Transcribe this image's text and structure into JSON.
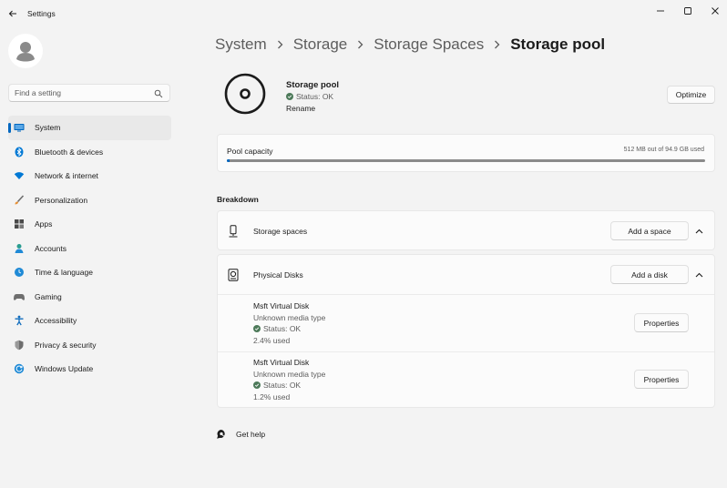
{
  "window": {
    "title": "Settings",
    "back_icon": "back-arrow-icon",
    "controls": [
      "minimize-icon",
      "maximize-icon",
      "close-icon"
    ]
  },
  "search": {
    "placeholder": "Find a setting",
    "value": ""
  },
  "sidebar": {
    "items": [
      {
        "label": "System",
        "icon": "system-icon",
        "active": true,
        "color": "#0067c0"
      },
      {
        "label": "Bluetooth & devices",
        "icon": "bluetooth-icon",
        "color": "#0078d4"
      },
      {
        "label": "Network & internet",
        "icon": "wifi-icon",
        "color": "#0078d4"
      },
      {
        "label": "Personalization",
        "icon": "brush-icon",
        "color": "#6e6e6e"
      },
      {
        "label": "Apps",
        "icon": "apps-icon",
        "color": "#4a4a4a"
      },
      {
        "label": "Accounts",
        "icon": "accounts-icon",
        "color": "#2a9d8f"
      },
      {
        "label": "Time & language",
        "icon": "globe-clock-icon",
        "color": "#1f8ad6"
      },
      {
        "label": "Gaming",
        "icon": "gamepad-icon",
        "color": "#6e6e6e"
      },
      {
        "label": "Accessibility",
        "icon": "accessibility-icon",
        "color": "#0f6cbd"
      },
      {
        "label": "Privacy & security",
        "icon": "shield-icon",
        "color": "#6e6e6e"
      },
      {
        "label": "Windows Update",
        "icon": "update-icon",
        "color": "#1f8ad6"
      }
    ]
  },
  "breadcrumb": [
    "System",
    "Storage",
    "Storage Spaces",
    "Storage pool"
  ],
  "pool": {
    "name": "Storage pool",
    "status": "Status: OK",
    "rename": "Rename",
    "optimize": "Optimize"
  },
  "capacity": {
    "label": "Pool capacity",
    "usage": "512 MB out of 94.9 GB used",
    "used_fraction": 0.005
  },
  "breakdown": {
    "title": "Breakdown",
    "spaces": {
      "label": "Storage spaces",
      "button": "Add a space"
    },
    "disks": {
      "label": "Physical Disks",
      "button": "Add a disk",
      "items": [
        {
          "name": "Msft Virtual Disk",
          "type": "Unknown media type",
          "status": "Status: OK",
          "used": "2.4% used",
          "button": "Properties"
        },
        {
          "name": "Msft Virtual Disk",
          "type": "Unknown media type",
          "status": "Status: OK",
          "used": "1.2% used",
          "button": "Properties"
        }
      ]
    }
  },
  "help": {
    "label": "Get help"
  },
  "colors": {
    "accent": "#0067c0",
    "status_ok": "#4d7a5a"
  }
}
